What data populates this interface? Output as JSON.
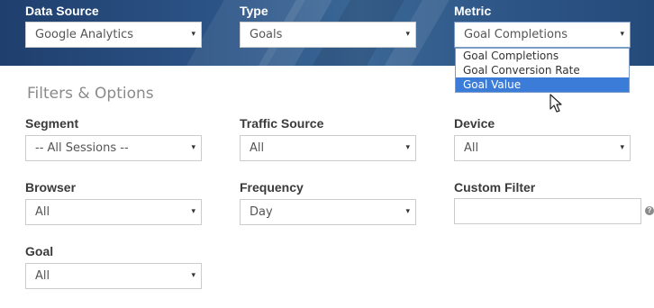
{
  "top": {
    "data_source": {
      "label": "Data Source",
      "value": "Google Analytics"
    },
    "type": {
      "label": "Type",
      "value": "Goals"
    },
    "metric": {
      "label": "Metric",
      "value": "Goal Completions",
      "options": [
        "Goal Completions",
        "Goal Conversion Rate",
        "Goal Value"
      ],
      "highlighted": "Goal Value"
    }
  },
  "filters": {
    "title": "Filters & Options",
    "segment": {
      "label": "Segment",
      "value": "-- All Sessions --"
    },
    "traffic_source": {
      "label": "Traffic Source",
      "value": "All"
    },
    "device": {
      "label": "Device",
      "value": "All"
    },
    "browser": {
      "label": "Browser",
      "value": "All"
    },
    "frequency": {
      "label": "Frequency",
      "value": "Day"
    },
    "custom_filter": {
      "label": "Custom Filter",
      "value": ""
    },
    "goal": {
      "label": "Goal",
      "value": "All"
    }
  },
  "icons": {
    "caret": "▾",
    "help": "?"
  },
  "colors": {
    "banner": "#2c5587",
    "highlight": "#3b7cd9"
  }
}
